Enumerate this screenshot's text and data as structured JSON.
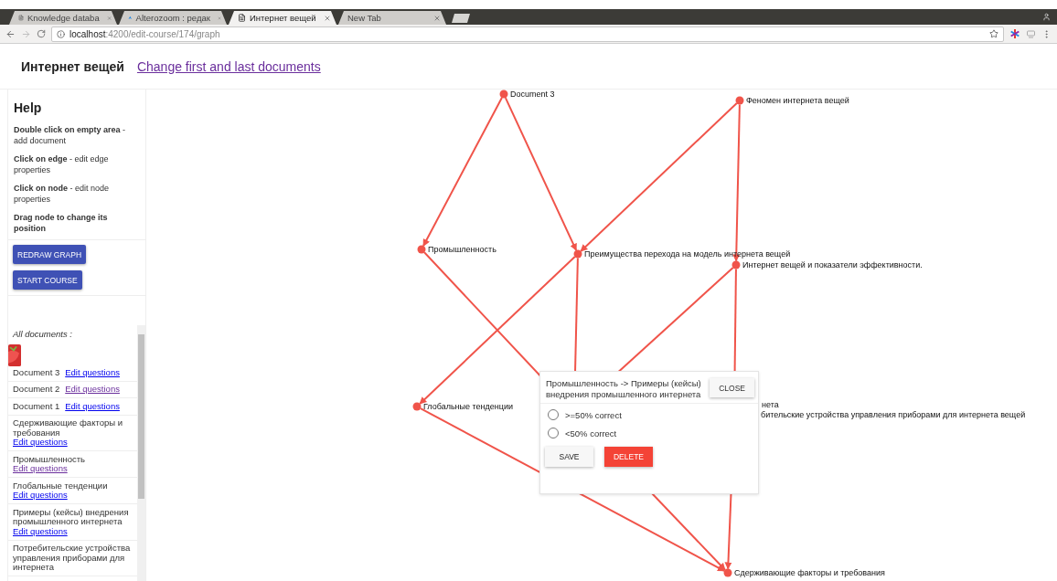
{
  "browser": {
    "tabs": [
      {
        "title": "Knowledge databa",
        "selected": false
      },
      {
        "title": "Alterozoom : редак",
        "selected": false
      },
      {
        "title": "Интернет вещей",
        "selected": true
      },
      {
        "title": "New Tab",
        "selected": false
      }
    ],
    "url_host": "localhost",
    "url_path": ":4200/edit-course/174/graph"
  },
  "header": {
    "title": "Интернет вещей",
    "link": "Change first and last documents"
  },
  "help": {
    "title": "Help",
    "items": [
      "**Double click on empty area** - add document",
      "**Click on edge** - edit edge properties",
      "**Click on node** - edit node properties",
      "**Drag node to change its position**"
    ]
  },
  "buttons": [
    "REDRAW GRAPH",
    "START COURSE"
  ],
  "documents": {
    "heading": "All documents :",
    "items": [
      {
        "name": "Document 3",
        "link": "Edit questions",
        "visited": false
      },
      {
        "name": "Document 2",
        "link": "Edit questions",
        "visited": true
      },
      {
        "name": "Document 1",
        "link": "Edit questions",
        "visited": false
      },
      {
        "name": "Сдерживающие факторы и требования",
        "link": "Edit questions",
        "visited": false
      },
      {
        "name": "Промышленность",
        "link": "Edit questions",
        "visited": true
      },
      {
        "name": "Глобальные тенденции",
        "link": "Edit questions",
        "visited": false
      },
      {
        "name": "Примеры (кейсы) внедрения промышленного интернета",
        "link": "Edit questions",
        "visited": false
      },
      {
        "name": "Потребительские устройства управления приборами для интернета"
      }
    ]
  },
  "graph": {
    "nodes": [
      {
        "label": "Document 3",
        "kind": "node"
      },
      {
        "label": "Феномен интернета вещей",
        "kind": "node"
      },
      {
        "label": "Промышленность",
        "kind": "node"
      },
      {
        "label": "Преимущества перехода на модель интернета вещей",
        "kind": "node"
      },
      {
        "label": "Интернет вещей и показатели эффективности.",
        "kind": "node"
      },
      {
        "label": "Глобальные тенденции",
        "kind": "node"
      },
      {
        "label": "нета",
        "kind": "covered"
      },
      {
        "label": "бительские устройства управления приборами для интернета вещей",
        "kind": "covered"
      },
      {
        "label": "Сдерживающие факторы и требования",
        "kind": "node"
      }
    ]
  },
  "dialog": {
    "title": "Промышленность -> Примеры (кейсы) внедрения промышленного интернета",
    "close": "CLOSE",
    "options": [
      {
        "label": ">=50% correct",
        "selected": false
      },
      {
        "label": "<50% correct",
        "selected": false
      }
    ],
    "save": "SAVE",
    "delete": "DELETE"
  }
}
